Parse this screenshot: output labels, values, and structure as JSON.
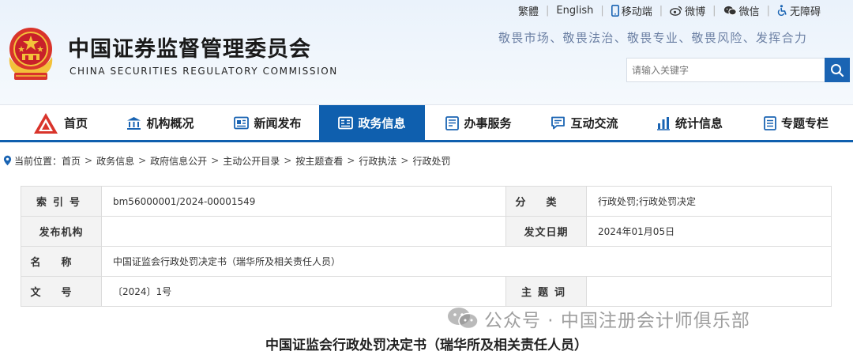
{
  "header": {
    "title": "中国证券监督管理委员会",
    "subtitle": "CHINA SECURITIES REGULATORY COMMISSION",
    "slogan": "敬畏市场、敬畏法治、敬畏专业、敬畏风险、发挥合力",
    "toplinks": {
      "traditional": "繁體",
      "english": "English",
      "mobile": "移动端",
      "weibo": "微博",
      "wechat": "微信",
      "accessibility": "无障碍"
    },
    "search": {
      "placeholder": "请输入关键字"
    }
  },
  "nav": {
    "items": [
      {
        "label": "首页",
        "icon": "home-logo-icon"
      },
      {
        "label": "机构概况",
        "icon": "institution-icon"
      },
      {
        "label": "新闻发布",
        "icon": "news-icon"
      },
      {
        "label": "政务信息",
        "icon": "gov-info-icon",
        "active": true
      },
      {
        "label": "办事服务",
        "icon": "service-icon"
      },
      {
        "label": "互动交流",
        "icon": "chat-icon"
      },
      {
        "label": "统计信息",
        "icon": "stats-icon"
      },
      {
        "label": "专题专栏",
        "icon": "topic-icon"
      }
    ],
    "active_color": "#0f5fae"
  },
  "breadcrumb": {
    "prefix": "当前位置：",
    "items": [
      "首页",
      "政务信息",
      "政府信息公开",
      "主动公开目录",
      "按主题查看",
      "行政执法",
      "行政处罚"
    ]
  },
  "info": {
    "index_label": "索引号",
    "index_value": "bm56000001/2024-00001549",
    "category_label": "分类",
    "category_value": "行政处罚;行政处罚决定",
    "issuer_label": "发布机构",
    "issuer_value": "",
    "date_label": "发文日期",
    "date_value": "2024年01月05日",
    "name_label": "名称",
    "name_value": "中国证监会行政处罚决定书（瑞华所及相关责任人员）",
    "docno_label": "文号",
    "docno_value": "〔2024〕1号",
    "keywords_label": "主题词",
    "keywords_value": ""
  },
  "doc_title": "中国证监会行政处罚决定书（瑞华所及相关责任人员）",
  "watermark": "公众号 · 中国注册会计师俱乐部"
}
